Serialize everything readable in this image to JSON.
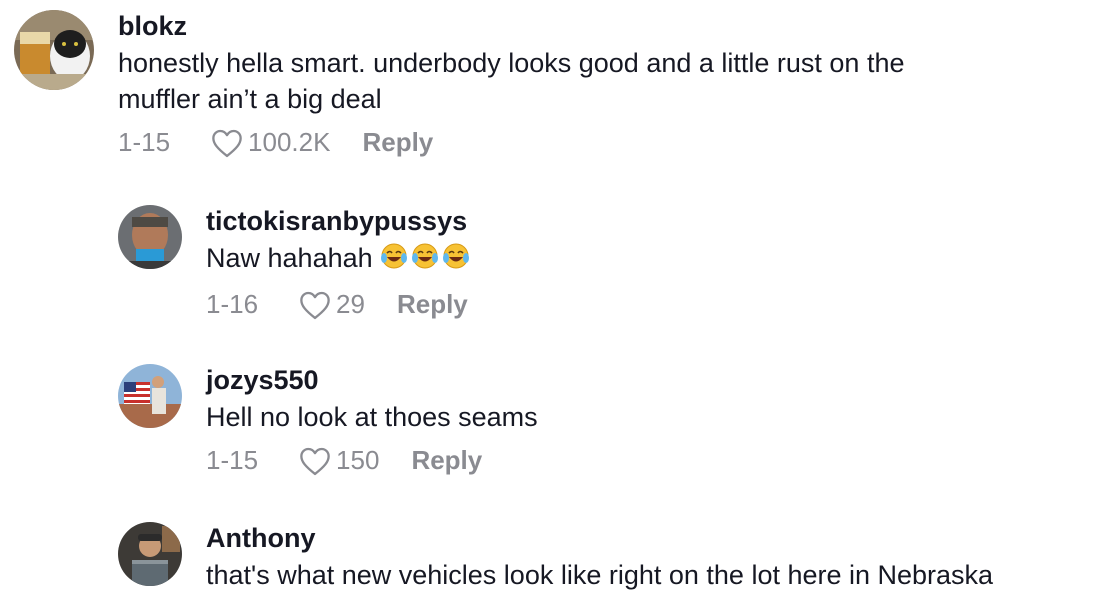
{
  "comments": [
    {
      "username": "blokz",
      "text_lines": [
        "honestly hella smart. underbody looks good and a little rust on the",
        "muffler ain’t a big deal"
      ],
      "date": "1-15",
      "likes": "100.2K",
      "reply_label": "Reply"
    },
    {
      "username": "tictokisranbypussys",
      "text": "Naw hahahah",
      "emoji": "face-with-tears-of-joy x3",
      "date": "1-16",
      "likes": "29",
      "reply_label": "Reply"
    },
    {
      "username": "jozys550",
      "text": "Hell no look at thoes seams",
      "date": "1-15",
      "likes": "150",
      "reply_label": "Reply"
    },
    {
      "username": "Anthony",
      "text": "that's what new vehicles look like right on the lot here in Nebraska"
    }
  ],
  "colors": {
    "text": "#161823",
    "secondary": "#8a8b91"
  }
}
